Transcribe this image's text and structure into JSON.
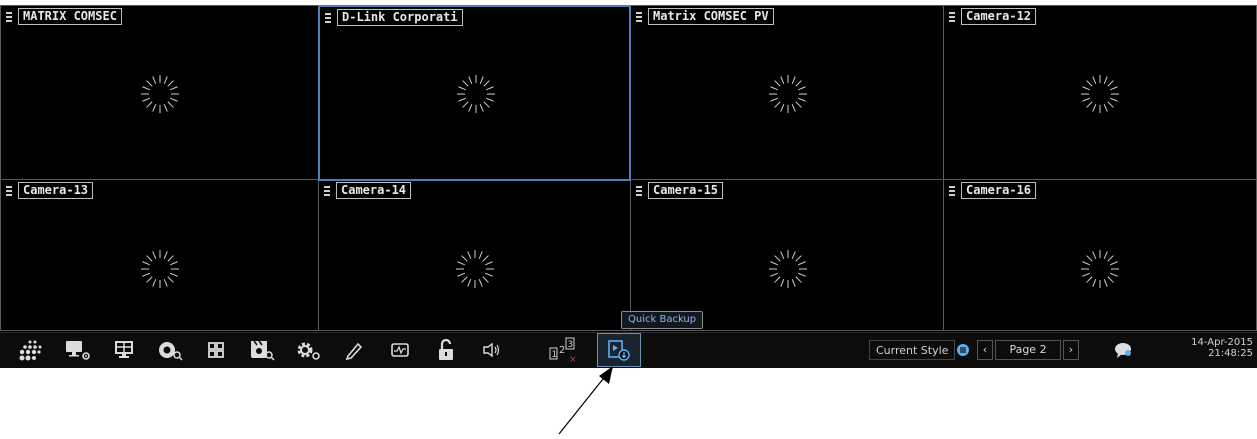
{
  "cameras": [
    {
      "title": "MATRIX COMSEC"
    },
    {
      "title": "D-Link Corporati"
    },
    {
      "title": "Matrix COMSEC PV"
    },
    {
      "title": "Camera-12"
    },
    {
      "title": "Camera-13"
    },
    {
      "title": "Camera-14"
    },
    {
      "title": "Camera-15"
    },
    {
      "title": "Camera-16"
    }
  ],
  "selected_camera_index": 1,
  "toolbar": {
    "tooltip": "Quick Backup",
    "style_label": "Current Style",
    "page_label": "Page 2",
    "date": "14-Apr-2015",
    "time": "21:48:25",
    "icons": [
      "grid-dots-icon",
      "monitor-settings-icon",
      "display-icon",
      "search-camera-icon",
      "layout-icon",
      "event-search-icon",
      "settings-icon",
      "pen-icon",
      "waveform-icon",
      "unlock-icon",
      "speaker-icon",
      "sequence-icon",
      "quick-backup-icon"
    ]
  },
  "colors": {
    "selected_border": "#4f7fb8",
    "accent": "#5ab0f0",
    "tooltip_text": "#8fb3e6"
  }
}
